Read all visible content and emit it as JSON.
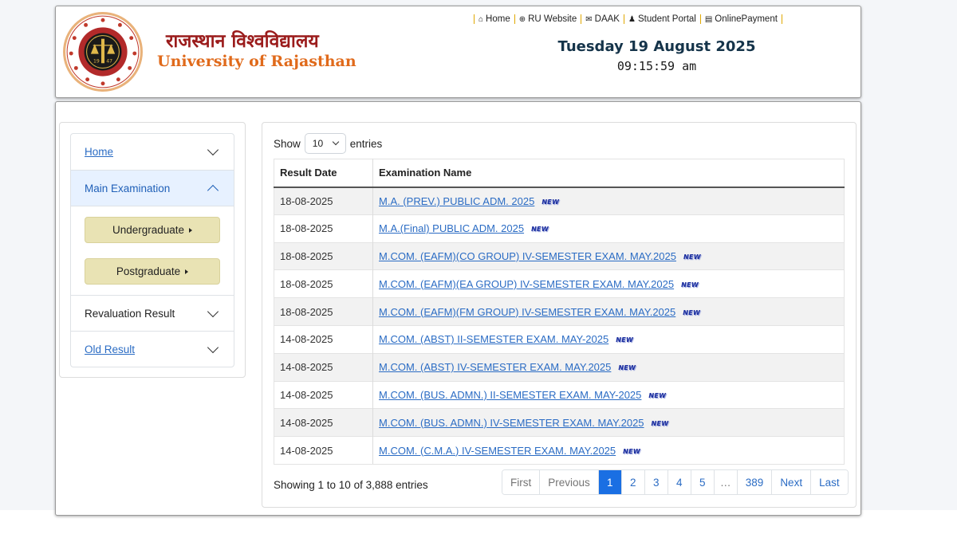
{
  "header": {
    "brand_hindi": "राजस्थान विश्वविद्यालय",
    "brand_english": "University of Rajasthan",
    "nav": [
      {
        "icon": "home-icon",
        "label": "Home"
      },
      {
        "icon": "globe-icon",
        "label": "RU Website"
      },
      {
        "icon": "envelope-icon",
        "label": "DAAK"
      },
      {
        "icon": "student-icon",
        "label": "Student Portal"
      },
      {
        "icon": "money-icon",
        "label": "OnlinePayment"
      }
    ],
    "date": "Tuesday 19 August 2025",
    "time": "09:15:59 am"
  },
  "sidebar": {
    "home": "Home",
    "main_exam": "Main Examination",
    "undergraduate": "Undergraduate",
    "postgraduate": "Postgraduate",
    "revaluation": "Revaluation Result",
    "old_result": "Old Result"
  },
  "table_controls": {
    "show_label": "Show",
    "page_length": "10",
    "entries_label": "entries",
    "info": "Showing 1 to 10 of 3,888 entries"
  },
  "table": {
    "columns": [
      "Result Date",
      "Examination Name"
    ],
    "badge": "NEW",
    "rows": [
      {
        "date": "18-08-2025",
        "name": "M.A. (PREV.) PUBLIC ADM. 2025"
      },
      {
        "date": "18-08-2025",
        "name": "M.A.(Final) PUBLIC ADM. 2025"
      },
      {
        "date": "18-08-2025",
        "name": "M.COM. (EAFM)(CO GROUP) IV-SEMESTER EXAM. MAY.2025"
      },
      {
        "date": "18-08-2025",
        "name": "M.COM. (EAFM)(EA GROUP) IV-SEMESTER EXAM. MAY.2025"
      },
      {
        "date": "18-08-2025",
        "name": "M.COM. (EAFM)(FM GROUP) IV-SEMESTER EXAM. MAY.2025"
      },
      {
        "date": "14-08-2025",
        "name": "M.COM. (ABST) II-SEMESTER EXAM. MAY-2025"
      },
      {
        "date": "14-08-2025",
        "name": "M.COM. (ABST) IV-SEMESTER EXAM. MAY.2025"
      },
      {
        "date": "14-08-2025",
        "name": "M.COM. (BUS. ADMN.) II-SEMESTER EXAM. MAY-2025"
      },
      {
        "date": "14-08-2025",
        "name": "M.COM. (BUS. ADMN.) IV-SEMESTER EXAM. MAY.2025"
      },
      {
        "date": "14-08-2025",
        "name": "M.COM. (C.M.A.) IV-SEMESTER EXAM. MAY.2025"
      }
    ]
  },
  "pagination": {
    "first": "First",
    "previous": "Previous",
    "pages": [
      "1",
      "2",
      "3",
      "4",
      "5"
    ],
    "ellipsis": "…",
    "last_page": "389",
    "next": "Next",
    "last": "Last",
    "active_page": "1"
  },
  "colors": {
    "brand_hindi": "#9b1c1c",
    "brand_english": "#e06a1b",
    "active_page": "#1a6fe3",
    "sub_button": "#e9e3b4",
    "link": "#2b6cc4"
  }
}
